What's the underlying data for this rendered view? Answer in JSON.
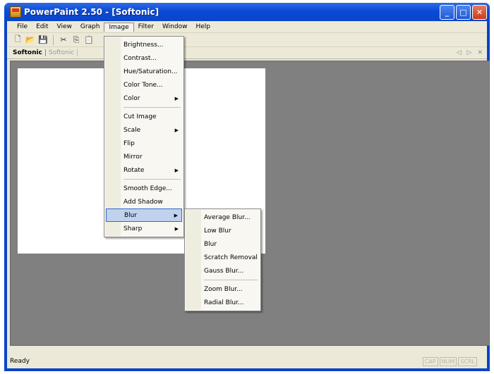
{
  "window": {
    "title": "PowerPaint 2.50 - [Softonic]",
    "minimize": "_",
    "maximize": "□",
    "close": "✕"
  },
  "menubar": [
    "File",
    "Edit",
    "View",
    "Graph",
    "Image",
    "Filter",
    "Window",
    "Help"
  ],
  "toolbar": {
    "new": "🗋",
    "open": "📂",
    "save": "💾",
    "cut": "✂",
    "copy": "⎘",
    "paste": "📋"
  },
  "tabs": {
    "active": "Softonic",
    "inactive": "Softonic",
    "prev": "◁",
    "next": "▷",
    "close": "✕"
  },
  "image_menu": [
    {
      "label": "Brightness...",
      "sub": false
    },
    {
      "label": "Contrast...",
      "sub": false
    },
    {
      "label": "Hue/Saturation...",
      "sub": false
    },
    {
      "label": "Color Tone...",
      "sub": false
    },
    {
      "label": "Color",
      "sub": true
    },
    {
      "sep": true
    },
    {
      "label": "Cut Image",
      "sub": false
    },
    {
      "label": "Scale",
      "sub": true
    },
    {
      "label": "Flip",
      "sub": false
    },
    {
      "label": "Mirror",
      "sub": false
    },
    {
      "label": "Rotate",
      "sub": true
    },
    {
      "sep": true
    },
    {
      "label": "Smooth Edge...",
      "sub": false
    },
    {
      "label": "Add Shadow",
      "sub": false
    },
    {
      "label": "Blur",
      "sub": true,
      "highlighted": true
    },
    {
      "label": "Sharp",
      "sub": true
    }
  ],
  "blur_menu": [
    {
      "label": "Average Blur..."
    },
    {
      "label": "Low Blur"
    },
    {
      "label": "Blur"
    },
    {
      "label": "Scratch Removal"
    },
    {
      "label": "Gauss Blur..."
    },
    {
      "sep": true
    },
    {
      "label": "Zoom Blur..."
    },
    {
      "label": "Radial Blur..."
    }
  ],
  "status": {
    "text": "Ready",
    "cap": "CAP",
    "num": "NUM",
    "scrl": "SCRL"
  }
}
